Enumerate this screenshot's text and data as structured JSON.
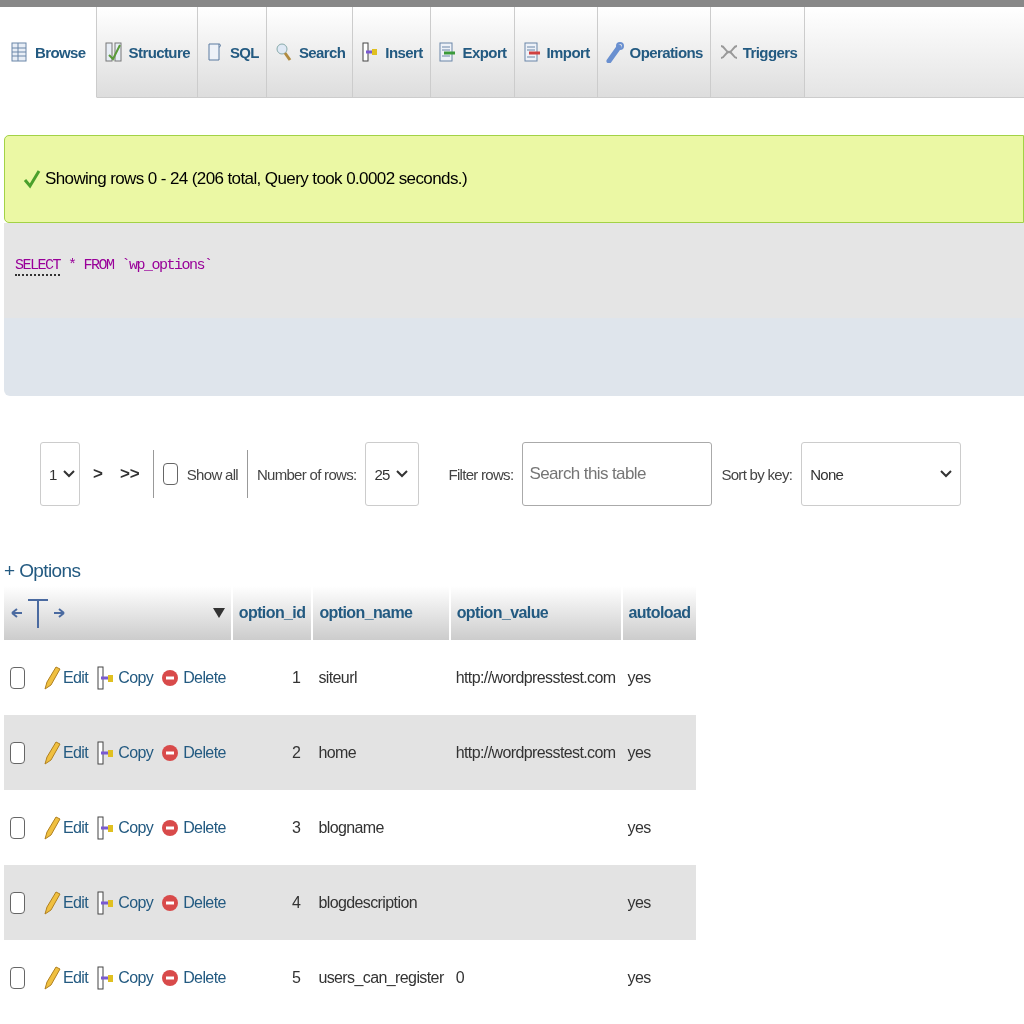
{
  "tabs": [
    {
      "label": "Browse",
      "selected": true
    },
    {
      "label": "Structure",
      "selected": false
    },
    {
      "label": "SQL",
      "selected": false
    },
    {
      "label": "Search",
      "selected": false
    },
    {
      "label": "Insert",
      "selected": false
    },
    {
      "label": "Export",
      "selected": false
    },
    {
      "label": "Import",
      "selected": false
    },
    {
      "label": "Operations",
      "selected": false
    },
    {
      "label": "Triggers",
      "selected": false
    }
  ],
  "message": "Showing rows 0 - 24 (206 total, Query took 0.0002 seconds.)",
  "query": [
    {
      "text": "SELECT",
      "kind": "keyword"
    },
    {
      "text": "*",
      "kind": "operator"
    },
    {
      "text": "FROM",
      "kind": "keyword2"
    },
    {
      "text": "`wp_options`",
      "kind": "identifier"
    }
  ],
  "navigation": {
    "page": "1",
    "next": ">",
    "last": ">>",
    "show_all": {
      "label": "Show all",
      "checked": false
    },
    "rows_label": "Number of rows:",
    "rows_value": "25",
    "filter_label": "Filter rows:",
    "filter_placeholder": "Search this table",
    "sort_label": "Sort by key:",
    "sort_value": "None"
  },
  "options_link": "+ Options",
  "table": {
    "columns": [
      "option_id",
      "option_name",
      "option_value",
      "autoload"
    ],
    "rows": [
      {
        "checked": false,
        "actions": [
          "Edit",
          "Copy",
          "Delete"
        ],
        "cells": [
          "1",
          "siteurl",
          "http://wordpresstest.com",
          "yes"
        ]
      },
      {
        "checked": false,
        "actions": [
          "Edit",
          "Copy",
          "Delete"
        ],
        "cells": [
          "2",
          "home",
          "http://wordpresstest.com",
          "yes"
        ]
      },
      {
        "checked": false,
        "actions": [
          "Edit",
          "Copy",
          "Delete"
        ],
        "cells": [
          "3",
          "blogname",
          null,
          "yes"
        ]
      },
      {
        "checked": false,
        "actions": [
          "Edit",
          "Copy",
          "Delete"
        ],
        "cells": [
          "4",
          "blogdescription",
          null,
          "yes"
        ]
      },
      {
        "checked": false,
        "actions": [
          "Edit",
          "Copy",
          "Delete"
        ],
        "cells": [
          "5",
          "users_can_register",
          "0",
          "yes"
        ]
      }
    ]
  }
}
